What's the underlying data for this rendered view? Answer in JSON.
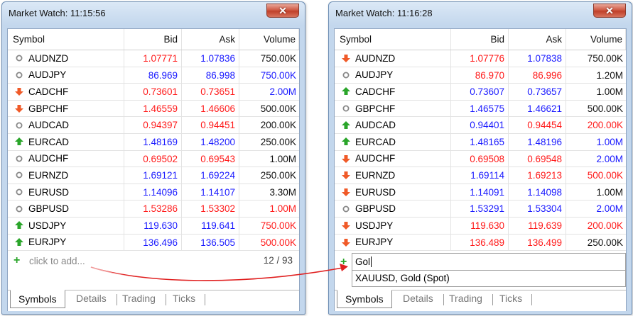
{
  "colors": {
    "red": "#ff1a1a",
    "blue": "#1a1aff",
    "black": "#111111",
    "up": "#2aa52a",
    "down": "#f05a28",
    "neutral": "#888888",
    "arrow": "#e02020"
  },
  "headers": {
    "symbol": "Symbol",
    "bid": "Bid",
    "ask": "Ask",
    "volume": "Volume"
  },
  "left": {
    "title": "Market Watch: 11:15:56",
    "close": "✕",
    "rows": [
      {
        "symbol": "AUDNZD",
        "icon": "neutral-circle-icon",
        "bid": "1.07771",
        "bidColor": "red",
        "ask": "1.07836",
        "askColor": "blue",
        "volume": "750.00K",
        "volColor": "black"
      },
      {
        "symbol": "AUDJPY",
        "icon": "neutral-circle-icon",
        "bid": "86.969",
        "bidColor": "blue",
        "ask": "86.998",
        "askColor": "blue",
        "volume": "750.00K",
        "volColor": "blue"
      },
      {
        "symbol": "CADCHF",
        "icon": "down-arrow-icon",
        "bid": "0.73601",
        "bidColor": "red",
        "ask": "0.73651",
        "askColor": "red",
        "volume": "2.00M",
        "volColor": "blue"
      },
      {
        "symbol": "GBPCHF",
        "icon": "down-arrow-icon",
        "bid": "1.46559",
        "bidColor": "red",
        "ask": "1.46606",
        "askColor": "red",
        "volume": "500.00K",
        "volColor": "black"
      },
      {
        "symbol": "AUDCAD",
        "icon": "neutral-circle-icon",
        "bid": "0.94397",
        "bidColor": "red",
        "ask": "0.94451",
        "askColor": "red",
        "volume": "200.00K",
        "volColor": "black"
      },
      {
        "symbol": "EURCAD",
        "icon": "up-arrow-icon",
        "bid": "1.48169",
        "bidColor": "blue",
        "ask": "1.48200",
        "askColor": "blue",
        "volume": "250.00K",
        "volColor": "black"
      },
      {
        "symbol": "AUDCHF",
        "icon": "neutral-circle-icon",
        "bid": "0.69502",
        "bidColor": "red",
        "ask": "0.69543",
        "askColor": "red",
        "volume": "1.00M",
        "volColor": "black"
      },
      {
        "symbol": "EURNZD",
        "icon": "neutral-circle-icon",
        "bid": "1.69121",
        "bidColor": "blue",
        "ask": "1.69224",
        "askColor": "blue",
        "volume": "250.00K",
        "volColor": "black"
      },
      {
        "symbol": "EURUSD",
        "icon": "neutral-circle-icon",
        "bid": "1.14096",
        "bidColor": "blue",
        "ask": "1.14107",
        "askColor": "blue",
        "volume": "3.30M",
        "volColor": "black"
      },
      {
        "symbol": "GBPUSD",
        "icon": "neutral-circle-icon",
        "bid": "1.53286",
        "bidColor": "red",
        "ask": "1.53302",
        "askColor": "red",
        "volume": "1.00M",
        "volColor": "red"
      },
      {
        "symbol": "USDJPY",
        "icon": "up-arrow-icon",
        "bid": "119.630",
        "bidColor": "blue",
        "ask": "119.641",
        "askColor": "blue",
        "volume": "750.00K",
        "volColor": "red"
      },
      {
        "symbol": "EURJPY",
        "icon": "up-arrow-icon",
        "bid": "136.496",
        "bidColor": "blue",
        "ask": "136.505",
        "askColor": "blue",
        "volume": "500.00K",
        "volColor": "red"
      }
    ],
    "add_text": "click to add...",
    "count": "12 / 93",
    "tabs": [
      "Symbols",
      "Details",
      "Trading",
      "Ticks"
    ]
  },
  "right": {
    "title": "Market Watch: 11:16:28",
    "close": "✕",
    "rows": [
      {
        "symbol": "AUDNZD",
        "icon": "down-arrow-icon",
        "bid": "1.07776",
        "bidColor": "red",
        "ask": "1.07838",
        "askColor": "blue",
        "volume": "750.00K",
        "volColor": "black"
      },
      {
        "symbol": "AUDJPY",
        "icon": "neutral-circle-icon",
        "bid": "86.970",
        "bidColor": "red",
        "ask": "86.996",
        "askColor": "red",
        "volume": "1.20M",
        "volColor": "black"
      },
      {
        "symbol": "CADCHF",
        "icon": "up-arrow-icon",
        "bid": "0.73607",
        "bidColor": "blue",
        "ask": "0.73657",
        "askColor": "blue",
        "volume": "1.00M",
        "volColor": "black"
      },
      {
        "symbol": "GBPCHF",
        "icon": "neutral-circle-icon",
        "bid": "1.46575",
        "bidColor": "blue",
        "ask": "1.46621",
        "askColor": "blue",
        "volume": "500.00K",
        "volColor": "black"
      },
      {
        "symbol": "AUDCAD",
        "icon": "up-arrow-icon",
        "bid": "0.94401",
        "bidColor": "blue",
        "ask": "0.94454",
        "askColor": "red",
        "volume": "200.00K",
        "volColor": "red"
      },
      {
        "symbol": "EURCAD",
        "icon": "up-arrow-icon",
        "bid": "1.48165",
        "bidColor": "blue",
        "ask": "1.48196",
        "askColor": "blue",
        "volume": "1.00M",
        "volColor": "blue"
      },
      {
        "symbol": "AUDCHF",
        "icon": "down-arrow-icon",
        "bid": "0.69508",
        "bidColor": "red",
        "ask": "0.69548",
        "askColor": "red",
        "volume": "2.00M",
        "volColor": "blue"
      },
      {
        "symbol": "EURNZD",
        "icon": "down-arrow-icon",
        "bid": "1.69114",
        "bidColor": "blue",
        "ask": "1.69213",
        "askColor": "red",
        "volume": "500.00K",
        "volColor": "red"
      },
      {
        "symbol": "EURUSD",
        "icon": "down-arrow-icon",
        "bid": "1.14091",
        "bidColor": "blue",
        "ask": "1.14098",
        "askColor": "blue",
        "volume": "1.00M",
        "volColor": "black"
      },
      {
        "symbol": "GBPUSD",
        "icon": "neutral-circle-icon",
        "bid": "1.53291",
        "bidColor": "blue",
        "ask": "1.53304",
        "askColor": "blue",
        "volume": "2.00M",
        "volColor": "blue"
      },
      {
        "symbol": "USDJPY",
        "icon": "down-arrow-icon",
        "bid": "119.630",
        "bidColor": "red",
        "ask": "119.639",
        "askColor": "red",
        "volume": "200.00K",
        "volColor": "red"
      },
      {
        "symbol": "EURJPY",
        "icon": "down-arrow-icon",
        "bid": "136.489",
        "bidColor": "red",
        "ask": "136.499",
        "askColor": "red",
        "volume": "250.00K",
        "volColor": "black"
      }
    ],
    "search_value": "Gol",
    "suggestion": "XAUUSD, Gold (Spot)",
    "tabs": [
      "Symbols",
      "Details",
      "Trading",
      "Ticks"
    ]
  }
}
